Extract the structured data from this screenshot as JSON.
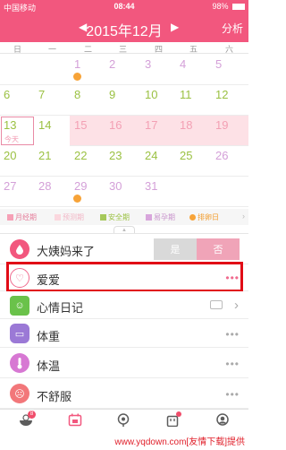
{
  "status": {
    "carrier": "中国移动",
    "time": "08:44",
    "battery": "98%"
  },
  "nav": {
    "title": "2015年12月",
    "prev": "◀",
    "next": "▶",
    "analysis": "分析"
  },
  "weekdays": [
    "日",
    "一",
    "二",
    "三",
    "四",
    "五",
    "六"
  ],
  "calendar": {
    "rows": [
      [
        "",
        "",
        "1",
        "2",
        "3",
        "4",
        "5"
      ],
      [
        "6",
        "7",
        "8",
        "9",
        "10",
        "11",
        "12"
      ],
      [
        "13",
        "14",
        "15",
        "16",
        "17",
        "18",
        "19"
      ],
      [
        "20",
        "21",
        "22",
        "23",
        "24",
        "25",
        "26"
      ],
      [
        "27",
        "28",
        "29",
        "30",
        "31",
        "",
        ""
      ]
    ],
    "today_label": "今天"
  },
  "legend": {
    "items": [
      {
        "label": "月经期",
        "color": "#f6a0b6"
      },
      {
        "label": "预测期",
        "color": "#fbd7de"
      },
      {
        "label": "安全期",
        "color": "#a6c85a"
      },
      {
        "label": "易孕期",
        "color": "#d8a5dc"
      },
      {
        "label": "排卵日",
        "color": "#f7a338"
      }
    ],
    "more": "›"
  },
  "rows": {
    "period": {
      "label": "大姨妈来了",
      "yes": "是",
      "no": "否"
    },
    "love": {
      "label": "爱爱",
      "more": "•••"
    },
    "mood": {
      "label": "心情日记",
      "more": "›"
    },
    "weight": {
      "label": "体重",
      "more": "•••"
    },
    "temp": {
      "label": "体温",
      "more": "•••"
    },
    "unwell": {
      "label": "不舒服",
      "more": "•••"
    }
  },
  "tabbar": {
    "badge_count": "8"
  },
  "watermark": "www.yqdown.com[友情下载]提供",
  "colors": {
    "brand": "#f2577e",
    "highlight": "#e10b16"
  }
}
